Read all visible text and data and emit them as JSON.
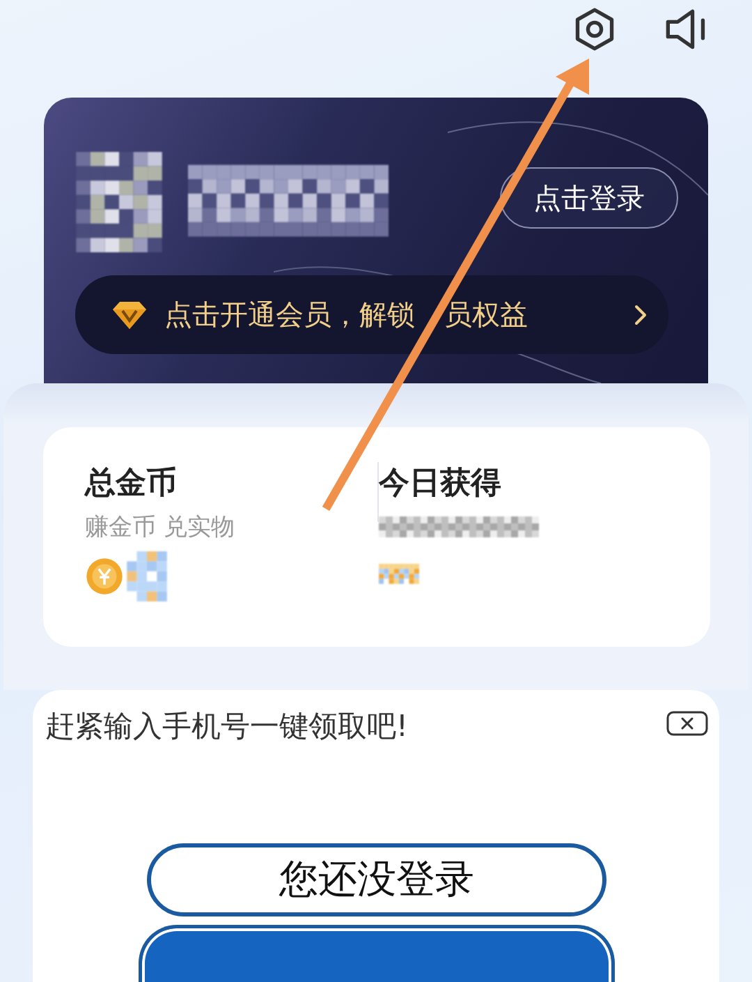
{
  "top_bar": {
    "icons": [
      {
        "kind": "settings"
      },
      {
        "kind": "sound"
      }
    ]
  },
  "profile_card": {
    "login_button": "点击登录",
    "membership_banner": {
      "text_before_arrow": "点击开通会员，解锁",
      "text_after_arrow": "员权益"
    }
  },
  "coins": [
    {
      "title": "总金币",
      "subtitle": "赚金币 兑实物"
    },
    {
      "title": "今日获得"
    }
  ],
  "login_prompt": {
    "message": "赶紧输入手机号一键领取吧!",
    "status_button": "您还没登录"
  }
}
